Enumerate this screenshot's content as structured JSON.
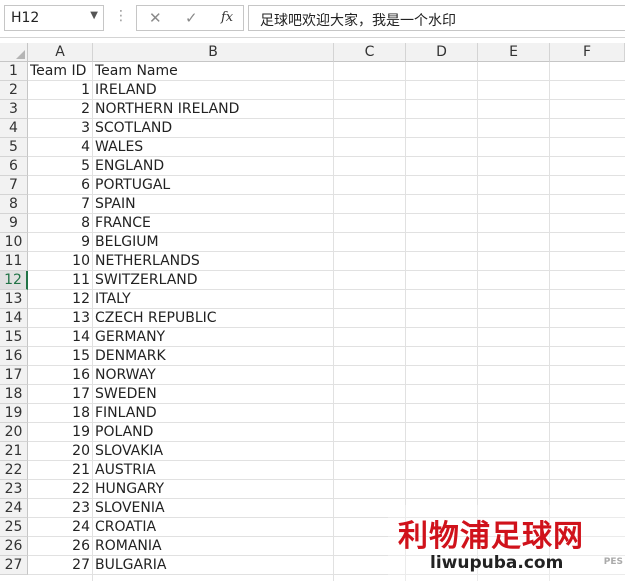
{
  "formula_bar": {
    "name_box": "H12",
    "cancel_icon": "✕",
    "enter_icon": "✓",
    "fx_label": "fx",
    "formula_text": "足球吧欢迎大家，我是一个水印"
  },
  "columns": [
    "A",
    "B",
    "C",
    "D",
    "E",
    "F"
  ],
  "selected_row": 12,
  "rows": [
    {
      "n": "1",
      "a": "Team ID",
      "b": "Team Name"
    },
    {
      "n": "2",
      "a": "1",
      "b": "IRELAND"
    },
    {
      "n": "3",
      "a": "2",
      "b": "NORTHERN IRELAND"
    },
    {
      "n": "4",
      "a": "3",
      "b": "SCOTLAND"
    },
    {
      "n": "5",
      "a": "4",
      "b": "WALES"
    },
    {
      "n": "6",
      "a": "5",
      "b": "ENGLAND"
    },
    {
      "n": "7",
      "a": "6",
      "b": "PORTUGAL"
    },
    {
      "n": "8",
      "a": "7",
      "b": "SPAIN"
    },
    {
      "n": "9",
      "a": "8",
      "b": "FRANCE"
    },
    {
      "n": "10",
      "a": "9",
      "b": "BELGIUM"
    },
    {
      "n": "11",
      "a": "10",
      "b": "NETHERLANDS"
    },
    {
      "n": "12",
      "a": "11",
      "b": "SWITZERLAND"
    },
    {
      "n": "13",
      "a": "12",
      "b": "ITALY"
    },
    {
      "n": "14",
      "a": "13",
      "b": "CZECH REPUBLIC"
    },
    {
      "n": "15",
      "a": "14",
      "b": "GERMANY"
    },
    {
      "n": "16",
      "a": "15",
      "b": "DENMARK"
    },
    {
      "n": "17",
      "a": "16",
      "b": "NORWAY"
    },
    {
      "n": "18",
      "a": "17",
      "b": "SWEDEN"
    },
    {
      "n": "19",
      "a": "18",
      "b": "FINLAND"
    },
    {
      "n": "20",
      "a": "19",
      "b": "POLAND"
    },
    {
      "n": "21",
      "a": "20",
      "b": "SLOVAKIA"
    },
    {
      "n": "22",
      "a": "21",
      "b": "AUSTRIA"
    },
    {
      "n": "23",
      "a": "22",
      "b": "HUNGARY"
    },
    {
      "n": "24",
      "a": "23",
      "b": "SLOVENIA"
    },
    {
      "n": "25",
      "a": "24",
      "b": "CROATIA"
    },
    {
      "n": "26",
      "a": "26",
      "b": "ROMANIA"
    },
    {
      "n": "27",
      "a": "27",
      "b": "BULGARIA"
    }
  ],
  "watermark": {
    "title": "利物浦足球网",
    "url": "liwupuba.com",
    "tag": "PES"
  },
  "colors": {
    "selection_accent": "#217346",
    "watermark_red": "#d0121b"
  }
}
